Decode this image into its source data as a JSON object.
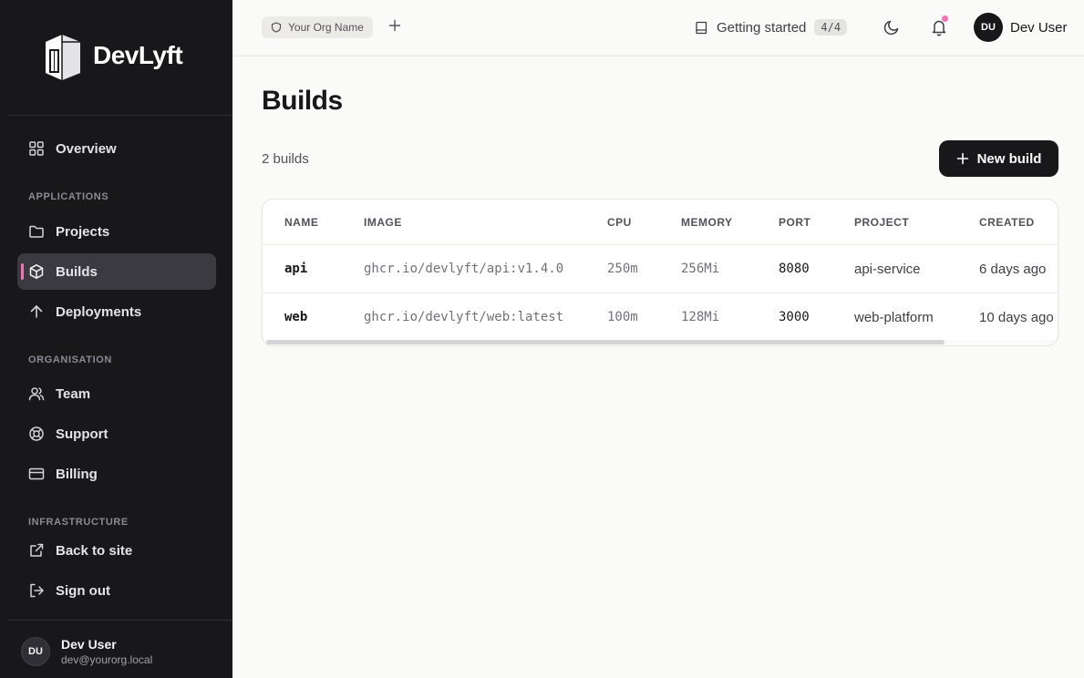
{
  "brand": {
    "name": "DevLyft"
  },
  "sidebar": {
    "overview": "Overview",
    "sections": {
      "applications": "APPLICATIONS",
      "organisation": "ORGANISATION",
      "infrastructure": "INFRASTRUCTURE"
    },
    "items": {
      "projects": "Projects",
      "builds": "Builds",
      "deployments": "Deployments",
      "team": "Team",
      "support": "Support",
      "billing": "Billing",
      "back_to_site": "Back to site",
      "sign_out": "Sign out"
    },
    "active_item": "Builds",
    "user": {
      "initials": "DU",
      "name": "Dev User",
      "email": "dev@yourorg.local"
    }
  },
  "topbar": {
    "org_name": "Your Org Name",
    "getting_started": "Getting started",
    "progress": "4/4",
    "user": {
      "initials": "DU",
      "name": "Dev User"
    }
  },
  "main": {
    "title": "Builds",
    "count": "2 builds",
    "new_build_label": "New build",
    "columns": {
      "name": "NAME",
      "image": "IMAGE",
      "cpu": "CPU",
      "memory": "MEMORY",
      "port": "PORT",
      "project": "PROJECT",
      "created": "CREATED"
    },
    "rows": [
      {
        "name": "api",
        "image": "ghcr.io/devlyft/api:v1.4.0",
        "cpu": "250m",
        "memory": "256Mi",
        "port": "8080",
        "project": "api-service",
        "created": "6 days ago"
      },
      {
        "name": "web",
        "image": "ghcr.io/devlyft/web:latest",
        "cpu": "100m",
        "memory": "128Mi",
        "port": "3000",
        "project": "web-platform",
        "created": "10 days ago"
      }
    ]
  },
  "colors": {
    "sidebar_bg": "#18181b",
    "active_indicator": "#f472b6",
    "primary_button": "#18181b",
    "page_bg": "#fafaf8"
  }
}
